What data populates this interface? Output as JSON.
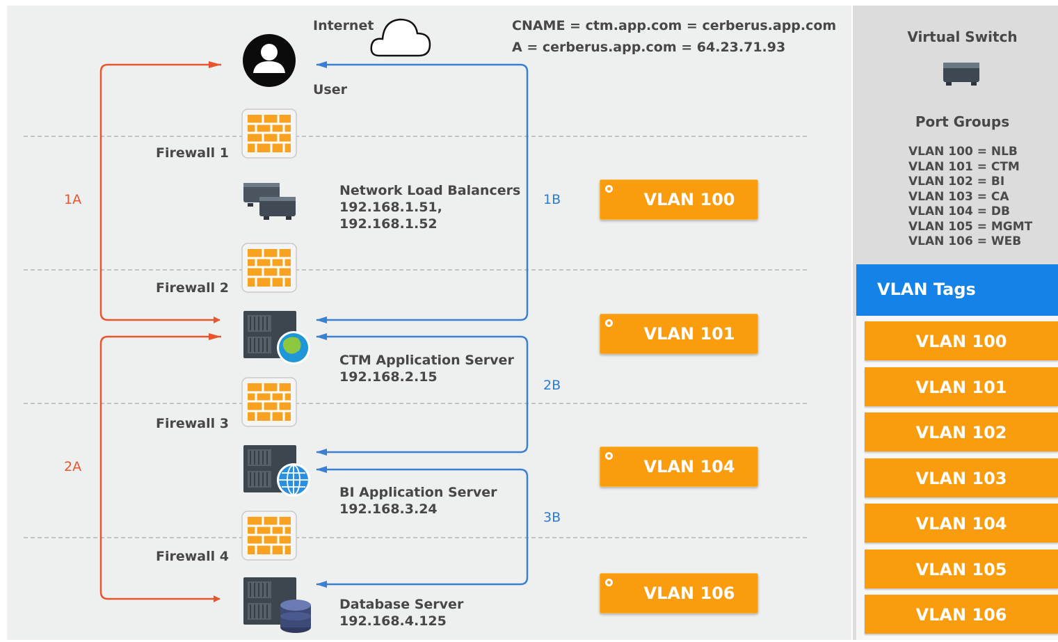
{
  "header": {
    "internet_label": "Internet",
    "dns_line1": "CNAME = ctm.app.com = cerberus.app.com",
    "dns_line2": "A = cerberus.app.com = 64.23.71.93"
  },
  "nodes": {
    "user": "User",
    "firewall1": "Firewall 1",
    "firewall2": "Firewall 2",
    "firewall3": "Firewall 3",
    "firewall4": "Firewall 4",
    "nlb": {
      "title": "Network Load Balancers",
      "ip1": "192.168.1.51,",
      "ip2": "192.168.1.52"
    },
    "ctm": {
      "title": "CTM Application Server",
      "ip": "192.168.2.15"
    },
    "bi": {
      "title": "BI Application Server",
      "ip": "192.168.3.24"
    },
    "db": {
      "title": "Database Server",
      "ip": "192.168.4.125"
    }
  },
  "routes": {
    "r1a": "1A",
    "r2a": "2A",
    "r1b": "1B",
    "r2b": "2B",
    "r3b": "3B"
  },
  "vlan_badges": [
    "VLAN 100",
    "VLAN 101",
    "VLAN 104",
    "VLAN 106"
  ],
  "sidebar": {
    "virtual_switch": "Virtual Switch",
    "port_groups": "Port Groups",
    "mappings": [
      "VLAN 100 = NLB",
      "VLAN 101 = CTM",
      "VLAN 102 = BI",
      "VLAN 103 = CA",
      "VLAN 104 = DB",
      "VLAN 105 = MGMT",
      "VLAN 106 = WEB"
    ],
    "tags_title": "VLAN Tags",
    "tags": [
      "VLAN 100",
      "VLAN 101",
      "VLAN 102",
      "VLAN 103",
      "VLAN 104",
      "VLAN 105",
      "VLAN 106"
    ]
  },
  "colors": {
    "orange_route": "#e8542d",
    "blue_route": "#3b7fd0",
    "vlan_orange": "#f99d0f",
    "tags_blue": "#1482e6"
  },
  "icons": {
    "user": "user-avatar-icon",
    "internet": "cloud-icon",
    "firewall": "firewall-brick-icon",
    "load_balancer": "server-stack-icon",
    "server": "server-tower-icon",
    "web": "globe-icon",
    "database": "database-icon",
    "switch": "network-switch-icon"
  }
}
